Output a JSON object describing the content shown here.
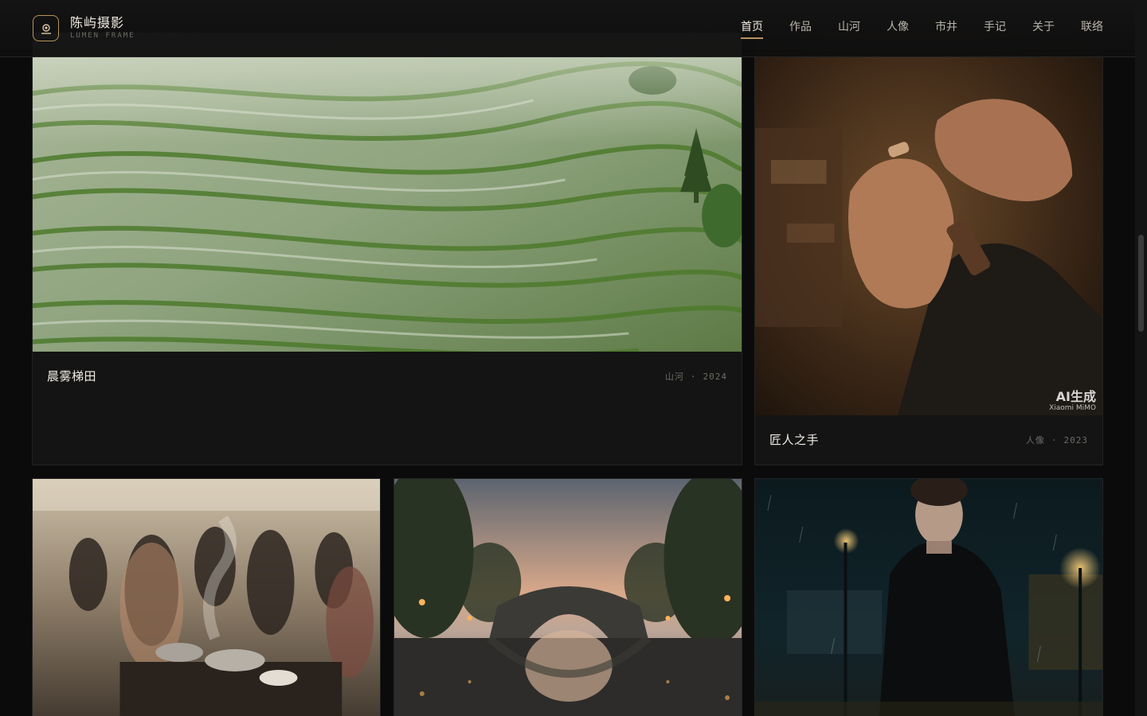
{
  "brand": {
    "name": "陈屿摄影",
    "subtitle": "LUMEN FRAME",
    "accent_color": "#b7935a",
    "logo_icon": "camera-icon"
  },
  "nav": {
    "items": [
      {
        "label": "首页",
        "active": true
      },
      {
        "label": "作品",
        "active": false
      },
      {
        "label": "山河",
        "active": false
      },
      {
        "label": "人像",
        "active": false
      },
      {
        "label": "市井",
        "active": false
      },
      {
        "label": "手记",
        "active": false
      },
      {
        "label": "关于",
        "active": false
      },
      {
        "label": "联络",
        "active": false
      }
    ]
  },
  "gallery": {
    "featured": [
      {
        "title": "晨雾梯田",
        "category": "山河",
        "year": "2024",
        "separator": "·"
      },
      {
        "title": "匠人之手",
        "category": "人像",
        "year": "2023",
        "separator": "·",
        "badge": {
          "main": "AI生成",
          "sub": "Xiaomi MiMO"
        }
      }
    ],
    "row2": [
      {
        "description": "market"
      },
      {
        "description": "bridge"
      },
      {
        "description": "portrait-rain"
      }
    ]
  }
}
